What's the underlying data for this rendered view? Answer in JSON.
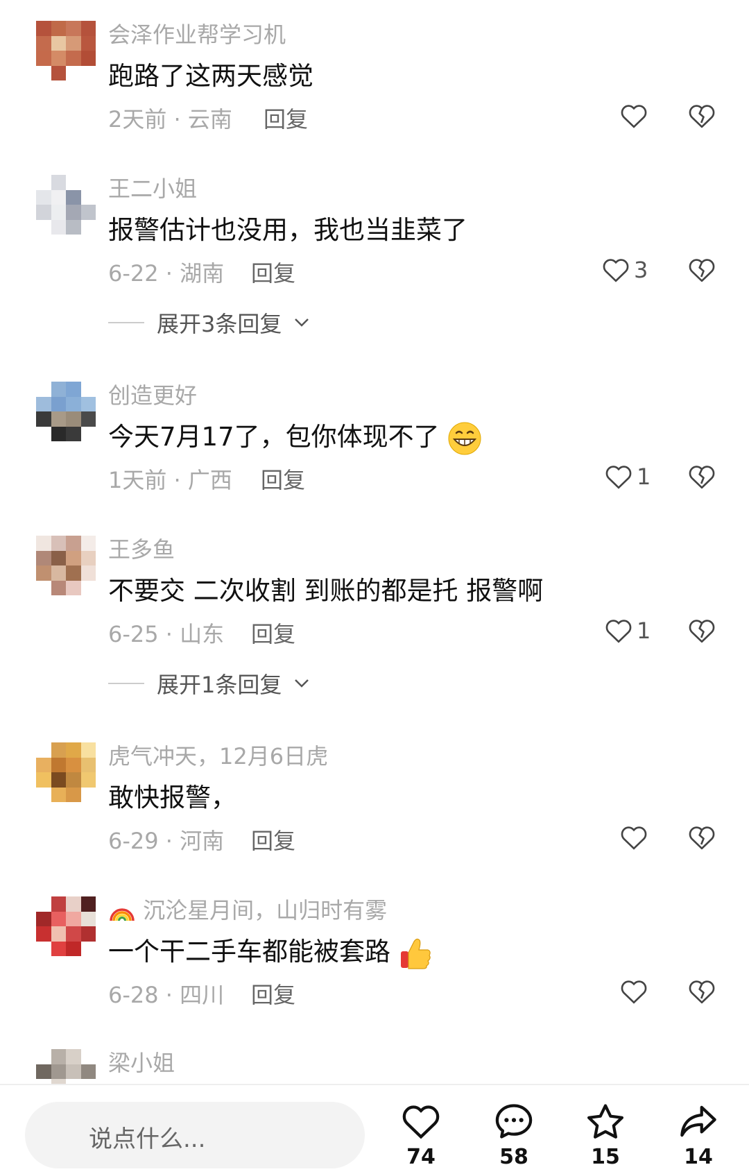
{
  "comments": [
    {
      "name": "会泽作业帮学习机",
      "text": "跑路了这两天感觉",
      "meta": "2天前 · 云南",
      "reply": "回复",
      "likes": ""
    },
    {
      "name": "王二小姐",
      "text": "报警估计也没用，我也当韭菜了",
      "meta": "6-22 · 湖南",
      "reply": "回复",
      "likes": "3",
      "expand": "展开3条回复"
    },
    {
      "name": "创造更好",
      "text": "今天7月17了，包你体现不了",
      "meta": "1天前 · 广西",
      "reply": "回复",
      "likes": "1"
    },
    {
      "name": "王多鱼",
      "text": "不要交 二次收割 到账的都是托 报警啊",
      "meta": "6-25 · 山东",
      "reply": "回复",
      "likes": "1",
      "expand": "展开1条回复"
    },
    {
      "name": "虎气冲天，12月6日虎",
      "text": "敢快报警，",
      "meta": "6-29 · 河南",
      "reply": "回复",
      "likes": ""
    },
    {
      "name": "沉沦星月间，山归时有雾",
      "text": "一个干二手车都能被套路",
      "meta": "6-28 · 四川",
      "reply": "回复",
      "likes": ""
    },
    {
      "name": "梁小姐"
    }
  ],
  "bottom": {
    "input_placeholder": "说点什么...",
    "like_count": "74",
    "comment_count": "58",
    "fav_count": "15",
    "share_count": "14"
  },
  "colors": {
    "muted": "#a8a8a8",
    "text": "#111111",
    "icon": "#444444"
  }
}
